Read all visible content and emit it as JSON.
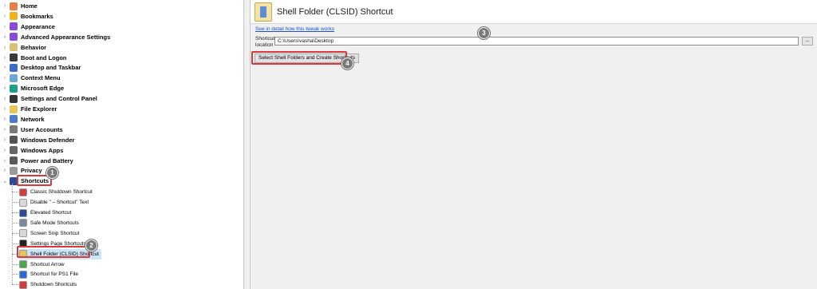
{
  "tree": {
    "top_items": [
      {
        "label": "Home",
        "color": "#e2804a"
      },
      {
        "label": "Bookmarks",
        "color": "#f0b21c"
      },
      {
        "label": "Appearance",
        "color": "#8a4bd6"
      },
      {
        "label": "Advanced Appearance Settings",
        "color": "#8a4bd6"
      },
      {
        "label": "Behavior",
        "color": "#d8c07a"
      },
      {
        "label": "Boot and Logon",
        "color": "#3a3a3a"
      },
      {
        "label": "Desktop and Taskbar",
        "color": "#3a6fc4"
      },
      {
        "label": "Context Menu",
        "color": "#6aa8d8"
      },
      {
        "label": "Microsoft Edge",
        "color": "#1f9e8a"
      },
      {
        "label": "Settings and Control Panel",
        "color": "#333333"
      },
      {
        "label": "File Explorer",
        "color": "#e7c35a"
      },
      {
        "label": "Network",
        "color": "#4a7cc8"
      },
      {
        "label": "User Accounts",
        "color": "#7a7a7a"
      },
      {
        "label": "Windows Defender",
        "color": "#555555"
      },
      {
        "label": "Windows Apps",
        "color": "#666666"
      },
      {
        "label": "Power and Battery",
        "color": "#5a5a5a"
      },
      {
        "label": "Privacy",
        "color": "#9a9a9a"
      },
      {
        "label": "Shortcuts",
        "color": "#2a4a9a"
      }
    ],
    "children": [
      {
        "label": "Classic Shutdown Shortcut",
        "color": "#d83a3a"
      },
      {
        "label": "Disable \" – Shortcut\" Text",
        "color": "#d8d8d8"
      },
      {
        "label": "Elevated Shortcut",
        "color": "#2a4a9a"
      },
      {
        "label": "Safe Mode Shortcuts",
        "color": "#7a8aa0"
      },
      {
        "label": "Screen Snip Shortcut",
        "color": "#d8d8d8"
      },
      {
        "label": "Settings Page Shortcuts",
        "color": "#222222"
      },
      {
        "label": "Shell Folder (CLSID) Shortcut",
        "color": "#e7c35a"
      },
      {
        "label": "Shortcut Arrow",
        "color": "#4aa84a"
      },
      {
        "label": "Shortcut for PS1 File",
        "color": "#2a6ad8"
      },
      {
        "label": "Shutdown Shortcuts",
        "color": "#d83a3a"
      }
    ]
  },
  "main": {
    "title": "Shell Folder (CLSID) Shortcut",
    "detail_link": "See in detail how this tweak works",
    "location_label_line1": "Shortcut",
    "location_label_line2": "location",
    "location_value": "C:\\Users\\vasha\\Desktop",
    "browse_label": "...",
    "select_button": "Select Shell Folders and Create Shortcuts"
  },
  "badges": [
    "1",
    "2",
    "3",
    "4"
  ],
  "colors": {
    "highlight": "#d83a3a",
    "badge": "#7a7a7a",
    "link": "#1a4fd8"
  }
}
